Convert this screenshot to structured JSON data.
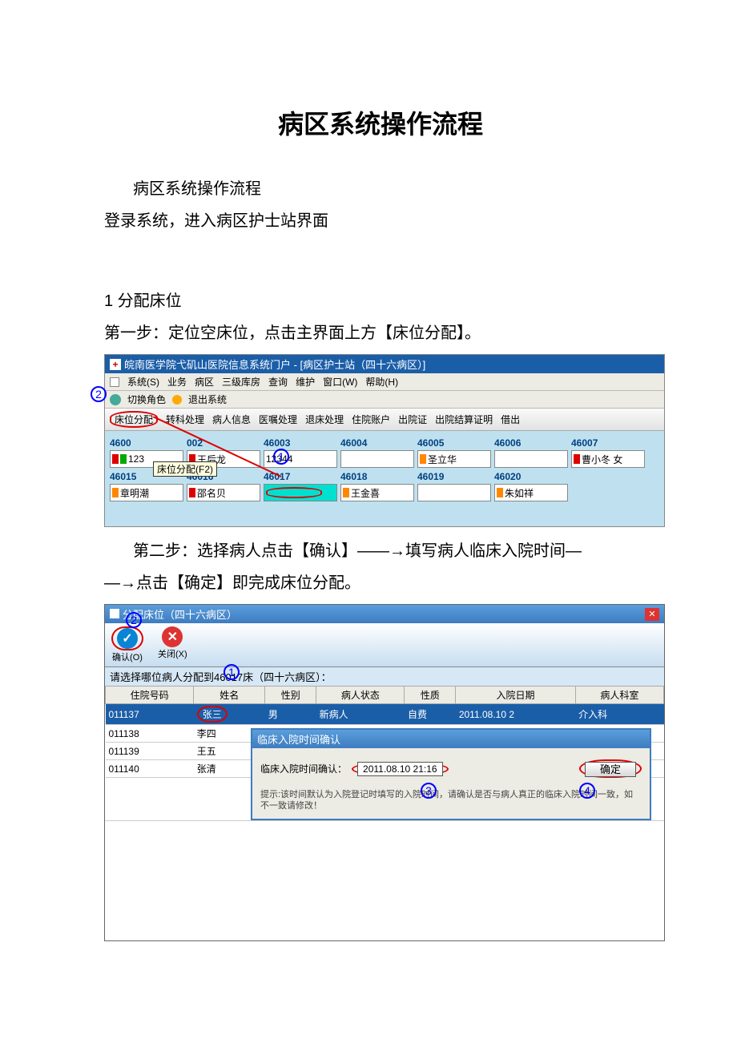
{
  "doc": {
    "title": "病区系统操作流程",
    "sub": "病区系统操作流程",
    "p1": "登录系统，进入病区护士站界面",
    "s1": "1 分配床位",
    "step1": "第一步：定位空床位，点击主界面上方【床位分配】。",
    "step2a": "第二步：选择病人点击【确认】——→填写病人临床入院时间—",
    "step2b": "—→点击【确定】即完成床位分配。"
  },
  "ss1": {
    "wintitle": "皖南医学院弋矶山医院信息系统门户 - [病区护士站（四十六病区）]",
    "menu": [
      "系统(S)",
      "业务",
      "病区",
      "三级库房",
      "查询",
      "维护",
      "窗口(W)",
      "帮助(H)"
    ],
    "switch": "切换角色",
    "exit": "退出系统",
    "toolbar": {
      "a": "床位分配",
      "b": "转科处理",
      "c": "病人信息",
      "d": "医嘱处理",
      "e": "退床处理",
      "f": "住院账户",
      "g": "出院证",
      "h": "出院结算证明",
      "i": "借出"
    },
    "tooltip": "床位分配(F2)",
    "beds_top_no": [
      "4600",
      "002",
      "46003",
      "46004",
      "46005",
      "46006",
      "46007"
    ],
    "beds_top_name": [
      "123",
      "王后龙",
      "12344",
      "",
      "圣立华",
      "",
      "曹小冬 女"
    ],
    "beds_bot_no": [
      "46015",
      "46016",
      "46017",
      "46018",
      "46019",
      "46020",
      ""
    ],
    "beds_bot_name": [
      "章明潮",
      "邵名贝",
      "",
      "王金喜",
      "",
      "朱如祥",
      ""
    ]
  },
  "ss2": {
    "wintitle": "分配床位（四十六病区）",
    "confirm": "确认(O)",
    "close": "关闭(X)",
    "prompt": "请选择哪位病人分配到46017床（四十六病区）：",
    "cols": [
      "住院号码",
      "姓名",
      "性别",
      "病人状态",
      "性质",
      "入院日期",
      "病人科室"
    ],
    "rows": [
      {
        "id": "011137",
        "name": "张三",
        "sex": "男",
        "st": "新病人",
        "nz": "自费",
        "dt": "2011.08.10 2",
        "dept": "介入科"
      },
      {
        "id": "011138",
        "name": "李四"
      },
      {
        "id": "011139",
        "name": "王五"
      },
      {
        "id": "011140",
        "name": "张清"
      }
    ],
    "mtitle": "临床入院时间确认",
    "mlabel": "临床入院时间确认：",
    "mval": "2011.08.10 21:16",
    "mok": "确定",
    "mhint": "提示:该时间默认为入院登记时填写的入院时间，请确认是否与病人真正的临床入院时间一致，如不一致请修改！"
  },
  "nums": {
    "n1": "1",
    "n2": "2",
    "n3": "3",
    "n4": "4"
  }
}
